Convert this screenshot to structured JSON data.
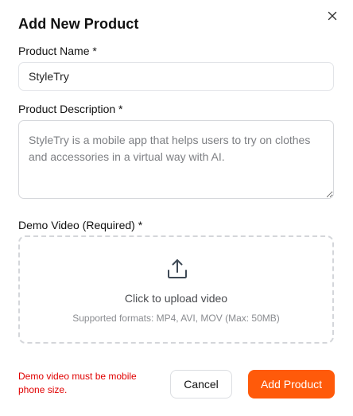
{
  "dialog": {
    "title": "Add New Product",
    "close_icon": "close-icon"
  },
  "form": {
    "name_label": "Product Name *",
    "name_value": "StyleTry",
    "description_label": "Product Description *",
    "description_value": "StyleTry is a mobile app that helps users to try on clothes and accessories in a virtual way with AI.",
    "video_label": "Demo Video (Required) *"
  },
  "upload": {
    "icon": "upload-icon",
    "prompt": "Click to upload video",
    "hint": "Supported formats: MP4, AVI, MOV (Max: 50MB)"
  },
  "footer": {
    "error_text": "Demo video must be mobile phone size.",
    "cancel_label": "Cancel",
    "submit_label": "Add Product"
  },
  "colors": {
    "primary": "#ff5a0a",
    "error": "#e00000"
  }
}
